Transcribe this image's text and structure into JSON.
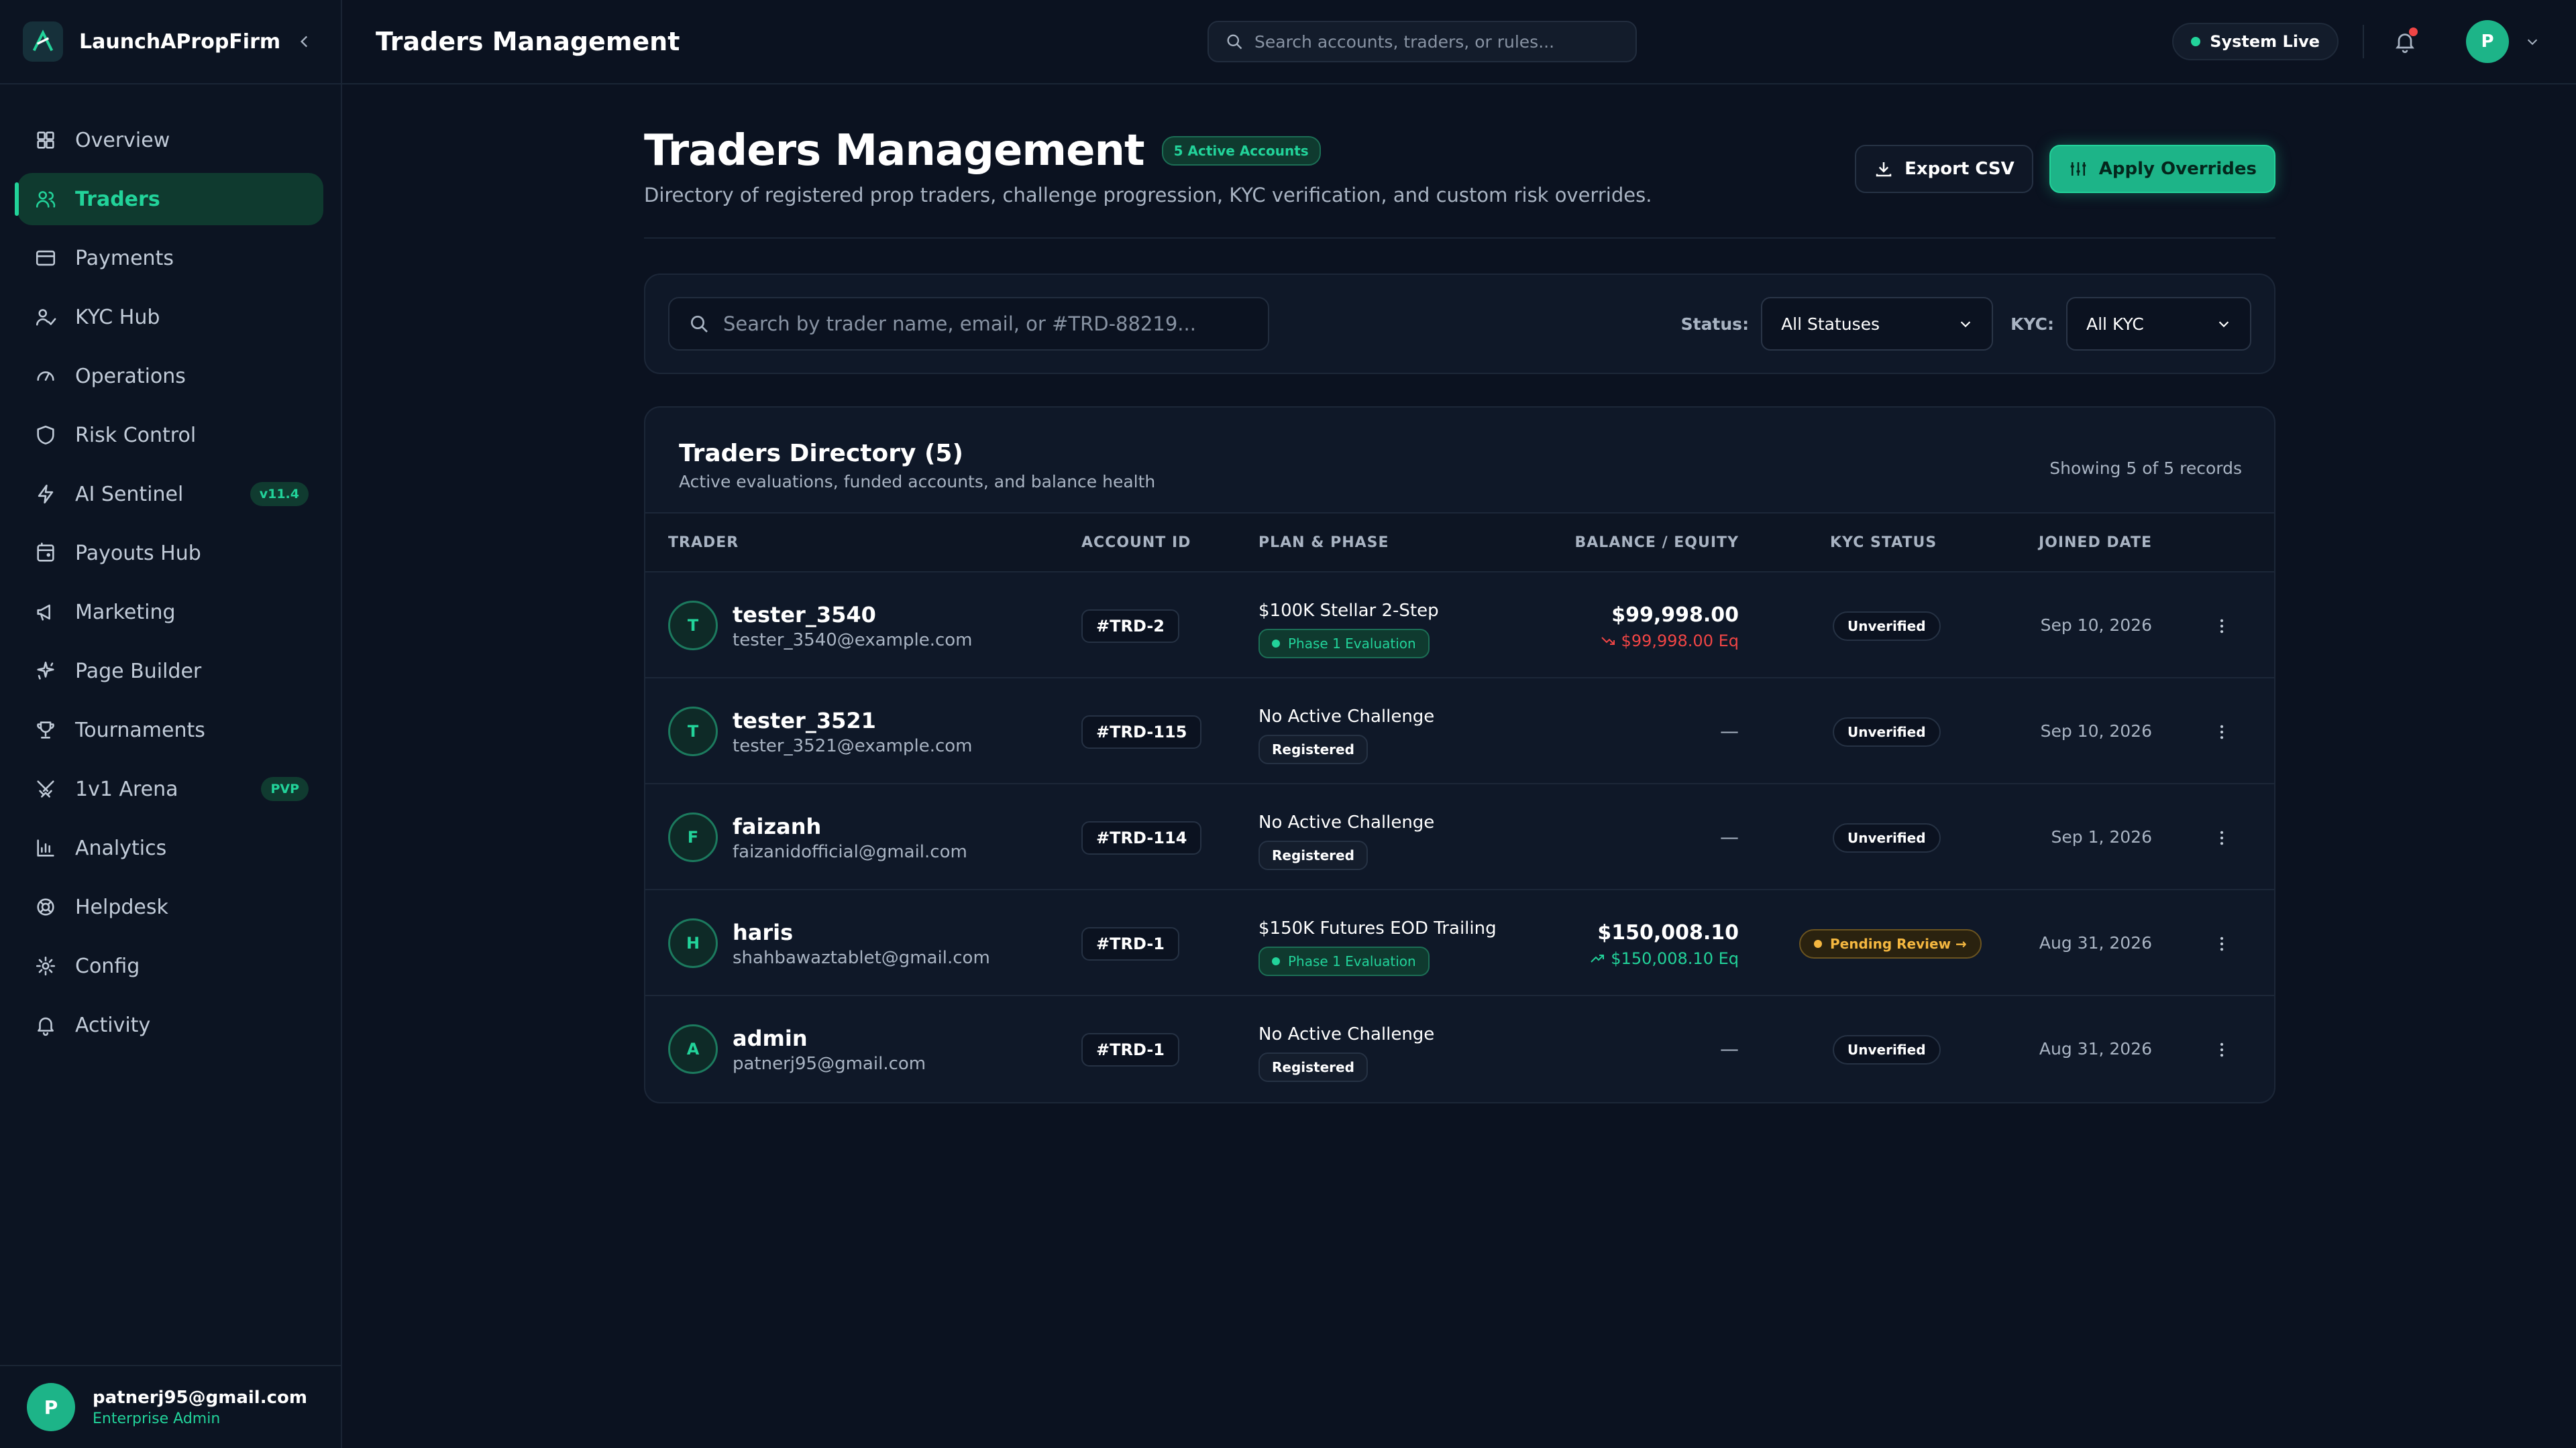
{
  "brand": {
    "name": "LaunchAPropFirm"
  },
  "sidebar": {
    "items": [
      {
        "label": "Overview",
        "icon": "grid-icon",
        "badge": ""
      },
      {
        "label": "Traders",
        "icon": "users-icon",
        "badge": ""
      },
      {
        "label": "Payments",
        "icon": "credit-card-icon",
        "badge": ""
      },
      {
        "label": "KYC Hub",
        "icon": "user-check-icon",
        "badge": ""
      },
      {
        "label": "Operations",
        "icon": "gauge-icon",
        "badge": ""
      },
      {
        "label": "Risk Control",
        "icon": "shield-icon",
        "badge": ""
      },
      {
        "label": "AI Sentinel",
        "icon": "bolt-icon",
        "badge": "v11.4"
      },
      {
        "label": "Payouts Hub",
        "icon": "wallet-icon",
        "badge": ""
      },
      {
        "label": "Marketing",
        "icon": "megaphone-icon",
        "badge": ""
      },
      {
        "label": "Page Builder",
        "icon": "sparkles-icon",
        "badge": ""
      },
      {
        "label": "Tournaments",
        "icon": "trophy-icon",
        "badge": ""
      },
      {
        "label": "1v1 Arena",
        "icon": "swords-icon",
        "badge": "PVP"
      },
      {
        "label": "Analytics",
        "icon": "bar-chart-icon",
        "badge": ""
      },
      {
        "label": "Helpdesk",
        "icon": "lifebuoy-icon",
        "badge": ""
      },
      {
        "label": "Config",
        "icon": "gear-icon",
        "badge": ""
      },
      {
        "label": "Activity",
        "icon": "bell-icon",
        "badge": ""
      }
    ],
    "active_index": 1,
    "user": {
      "initial": "P",
      "email": "patnerj95@gmail.com",
      "role": "Enterprise Admin"
    }
  },
  "topbar": {
    "title": "Traders Management",
    "search_placeholder": "Search accounts, traders, or rules...",
    "status": "System Live",
    "avatar_initial": "P"
  },
  "header": {
    "title": "Traders Management",
    "badge": "5 Active Accounts",
    "subtitle": "Directory of registered prop traders, challenge progression, KYC verification, and custom risk overrides.",
    "export_label": "Export CSV",
    "apply_label": "Apply Overrides"
  },
  "filters": {
    "search_placeholder": "Search by trader name, email, or #TRD-88219...",
    "status_label": "Status:",
    "status_value": "All Statuses",
    "kyc_label": "KYC:",
    "kyc_value": "All KYC"
  },
  "directory": {
    "title": "Traders Directory (5)",
    "subtitle": "Active evaluations, funded accounts, and balance health",
    "count": "Showing 5 of 5 records",
    "columns": [
      "TRADER",
      "ACCOUNT ID",
      "PLAN & PHASE",
      "BALANCE / EQUITY",
      "KYC STATUS",
      "JOINED DATE"
    ],
    "rows": [
      {
        "initial": "T",
        "name": "tester_3540",
        "email": "tester_3540@example.com",
        "account_id": "#TRD-2",
        "plan": "$100K Stellar 2-Step",
        "phase": "Phase 1 Evaluation",
        "phase_type": "eval",
        "balance": "$99,998.00",
        "equity": "$99,998.00 Eq",
        "trend": "down",
        "kyc": "Unverified",
        "kyc_type": "unverified",
        "joined": "Sep 10, 2026"
      },
      {
        "initial": "T",
        "name": "tester_3521",
        "email": "tester_3521@example.com",
        "account_id": "#TRD-115",
        "plan": "No Active Challenge",
        "phase": "Registered",
        "phase_type": "reg",
        "balance": "",
        "equity": "",
        "trend": "",
        "dash": "—",
        "kyc": "Unverified",
        "kyc_type": "unverified",
        "joined": "Sep 10, 2026"
      },
      {
        "initial": "F",
        "name": "faizanh",
        "email": "faizanidofficial@gmail.com",
        "account_id": "#TRD-114",
        "plan": "No Active Challenge",
        "phase": "Registered",
        "phase_type": "reg",
        "balance": "",
        "equity": "",
        "trend": "",
        "dash": "—",
        "kyc": "Unverified",
        "kyc_type": "unverified",
        "joined": "Sep 1, 2026"
      },
      {
        "initial": "H",
        "name": "haris",
        "email": "shahbawaztablet@gmail.com",
        "account_id": "#TRD-1",
        "plan": "$150K Futures EOD Trailing",
        "phase": "Phase 1 Evaluation",
        "phase_type": "eval",
        "balance": "$150,008.10",
        "equity": "$150,008.10 Eq",
        "trend": "up",
        "kyc": "Pending Review →",
        "kyc_type": "pending",
        "joined": "Aug 31, 2026"
      },
      {
        "initial": "A",
        "name": "admin",
        "email": "patnerj95@gmail.com",
        "account_id": "#TRD-1",
        "plan": "No Active Challenge",
        "phase": "Registered",
        "phase_type": "reg",
        "balance": "",
        "equity": "",
        "trend": "",
        "dash": "—",
        "kyc": "Unverified",
        "kyc_type": "unverified",
        "joined": "Aug 31, 2026"
      }
    ]
  },
  "colors": {
    "accent": "#22d39a",
    "background": "#0b1220",
    "danger": "#f04545",
    "warning": "#f4b740"
  }
}
